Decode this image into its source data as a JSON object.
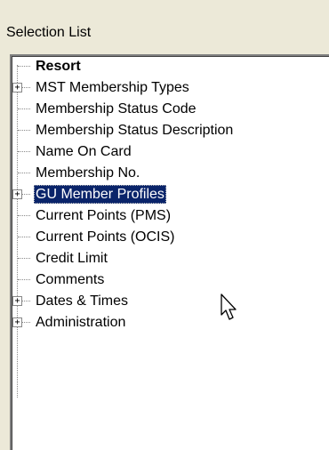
{
  "panel": {
    "title": "Selection List"
  },
  "tree": {
    "items": [
      {
        "label": "Resort",
        "bold": true,
        "expandable": false,
        "selected": false
      },
      {
        "label": "MST  Membership Types",
        "bold": false,
        "expandable": true,
        "selected": false
      },
      {
        "label": "Membership Status Code",
        "bold": false,
        "expandable": false,
        "selected": false
      },
      {
        "label": "Membership Status Description",
        "bold": false,
        "expandable": false,
        "selected": false
      },
      {
        "label": "Name On Card",
        "bold": false,
        "expandable": false,
        "selected": false
      },
      {
        "label": "Membership No.",
        "bold": false,
        "expandable": false,
        "selected": false
      },
      {
        "label": "GU  Member Profiles",
        "bold": false,
        "expandable": true,
        "selected": true
      },
      {
        "label": "Current Points (PMS)",
        "bold": false,
        "expandable": false,
        "selected": false
      },
      {
        "label": "Current Points (OCIS)",
        "bold": false,
        "expandable": false,
        "selected": false
      },
      {
        "label": "Credit Limit",
        "bold": false,
        "expandable": false,
        "selected": false
      },
      {
        "label": "Comments",
        "bold": false,
        "expandable": false,
        "selected": false
      },
      {
        "label": "Dates & Times",
        "bold": false,
        "expandable": true,
        "selected": false
      },
      {
        "label": "Administration",
        "bold": false,
        "expandable": true,
        "selected": false
      }
    ],
    "expander_glyph": "+"
  },
  "colors": {
    "selection_bg": "#0a246a",
    "selection_fg": "#ffffff",
    "window_bg": "#ece9d8"
  },
  "icons": {
    "cursor": "arrow-pointer-icon",
    "expander": "plus-box-icon"
  }
}
